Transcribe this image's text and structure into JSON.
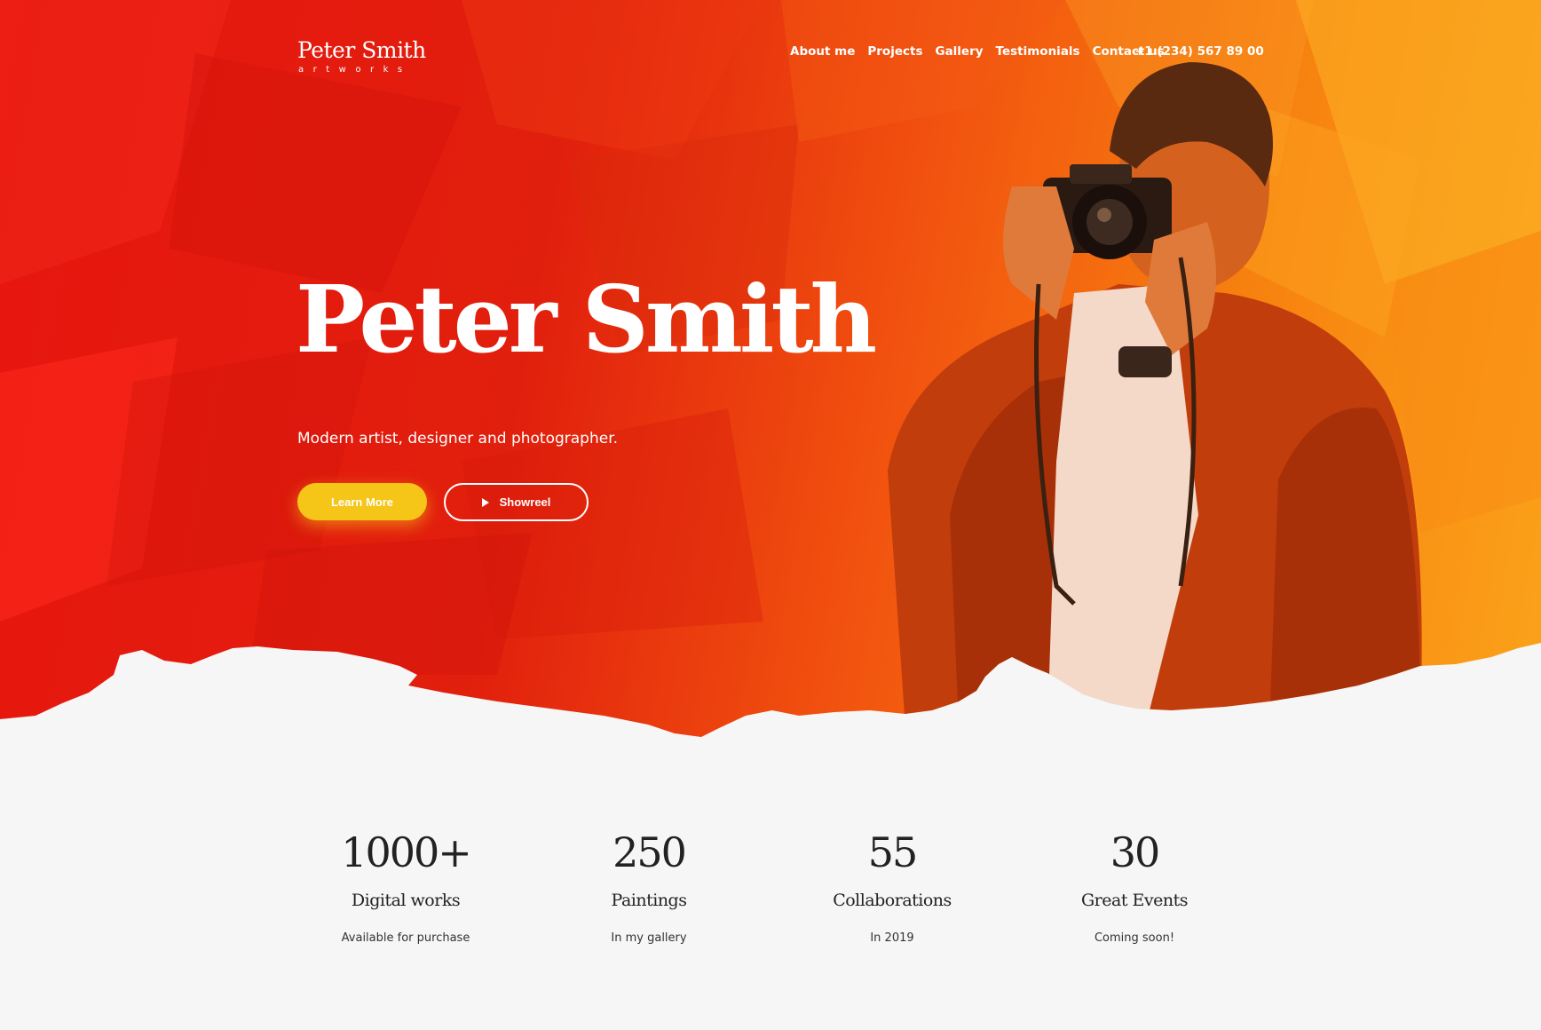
{
  "brand": {
    "name": "Peter Smith",
    "tagline": "artworks"
  },
  "nav": {
    "items": [
      {
        "label": "About me"
      },
      {
        "label": "Projects"
      },
      {
        "label": "Gallery"
      },
      {
        "label": "Testimonials"
      },
      {
        "label": "Contact us"
      }
    ],
    "phone": "+1 (234) 567 89 00"
  },
  "hero": {
    "title": "Peter Smith",
    "subtitle": "Modern artist, designer and photographer.",
    "primary_button": "Learn More",
    "secondary_button": "Showreel",
    "image_icon": "photographer-with-camera"
  },
  "stats": [
    {
      "number": "1000+",
      "title": "Digital works",
      "desc": "Available for purchase"
    },
    {
      "number": "250",
      "title": "Paintings",
      "desc": "In my gallery"
    },
    {
      "number": "55",
      "title": "Collaborations",
      "desc": "In 2019"
    },
    {
      "number": "30",
      "title": "Great Events",
      "desc": "Coming soon!"
    }
  ],
  "colors": {
    "hero_red": "#e11f0d",
    "hero_orange": "#f7820f",
    "accent_yellow": "#f5c518",
    "background": "#f6f6f6",
    "text_dark": "#222222"
  }
}
